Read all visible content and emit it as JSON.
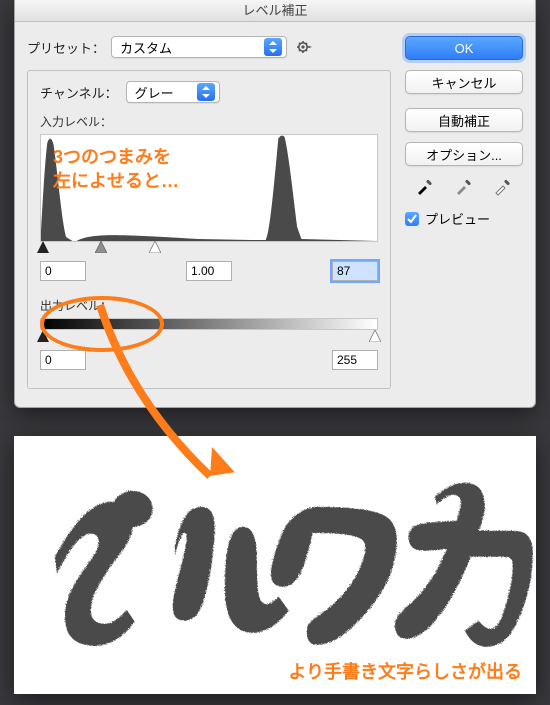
{
  "title": "レベル補正",
  "preset": {
    "label": "プリセット：",
    "value": "カスタム"
  },
  "channel": {
    "label": "チャンネル：",
    "value": "グレー"
  },
  "input_levels": {
    "label": "入力レベル：",
    "black": "0",
    "gamma": "1.00",
    "white": "87"
  },
  "output_levels": {
    "label": "出力レベル：",
    "black": "0",
    "white": "255"
  },
  "buttons": {
    "ok": "OK",
    "cancel": "キャンセル",
    "auto": "自動補正",
    "options": "オプション..."
  },
  "preview_label": "プレビュー",
  "annotations": {
    "tip_line1": "3つのつまみを",
    "tip_line2": "左によせると…",
    "result": "より手書き文字らしさが出る"
  },
  "icons": {
    "gear": "gear-icon",
    "chevron_updown": "chevron-updown-icon",
    "eyedropper_black": "eyedropper-black-icon",
    "eyedropper_gray": "eyedropper-gray-icon",
    "eyedropper_white": "eyedropper-white-icon",
    "check": "check-icon"
  },
  "colors": {
    "accent": "#ff7c1a",
    "button_primary": "#2f7df7"
  }
}
